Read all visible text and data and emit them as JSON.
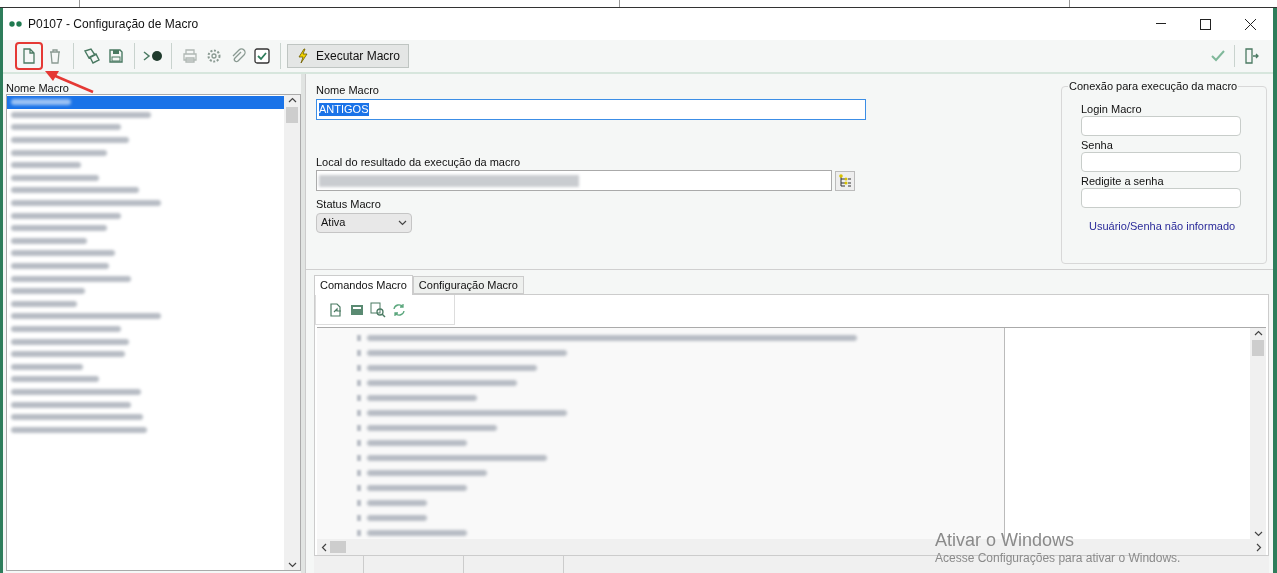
{
  "window": {
    "title": "P0107 - Configuração de Macro"
  },
  "toolbar": {
    "execute_button": "Executar Macro",
    "new_button_highlighted": true
  },
  "macro_list": {
    "label": "Nome Macro",
    "items": [
      {
        "selected": true
      },
      {
        "selected": false
      },
      {
        "selected": false
      },
      {
        "selected": false
      },
      {
        "selected": false
      },
      {
        "selected": false
      },
      {
        "selected": false
      },
      {
        "selected": false
      },
      {
        "selected": false
      },
      {
        "selected": false
      },
      {
        "selected": false
      },
      {
        "selected": false
      },
      {
        "selected": false
      },
      {
        "selected": false
      },
      {
        "selected": false
      },
      {
        "selected": false
      },
      {
        "selected": false
      },
      {
        "selected": false
      },
      {
        "selected": false
      },
      {
        "selected": false
      },
      {
        "selected": false
      },
      {
        "selected": false
      },
      {
        "selected": false
      },
      {
        "selected": false
      },
      {
        "selected": false
      },
      {
        "selected": false
      },
      {
        "selected": false
      }
    ]
  },
  "form": {
    "name_label": "Nome Macro",
    "name_value": "ANTIGOS",
    "result_label": "Local do resultado da execução da macro",
    "status_label": "Status Macro",
    "status_value": "Ativa"
  },
  "connection": {
    "title": "Conexão para execução da macro",
    "login_label": "Login Macro",
    "password_label": "Senha",
    "repeat_label": "Redigite a senha",
    "message": "Usuário/Senha não informado"
  },
  "tabs": [
    {
      "label": "Comandos Macro",
      "selected": true
    },
    {
      "label": "Configuração Macro",
      "selected": false
    }
  ],
  "activation": {
    "title": "Ativar o Windows",
    "subtitle": "Acesse Configurações para ativar o Windows."
  }
}
